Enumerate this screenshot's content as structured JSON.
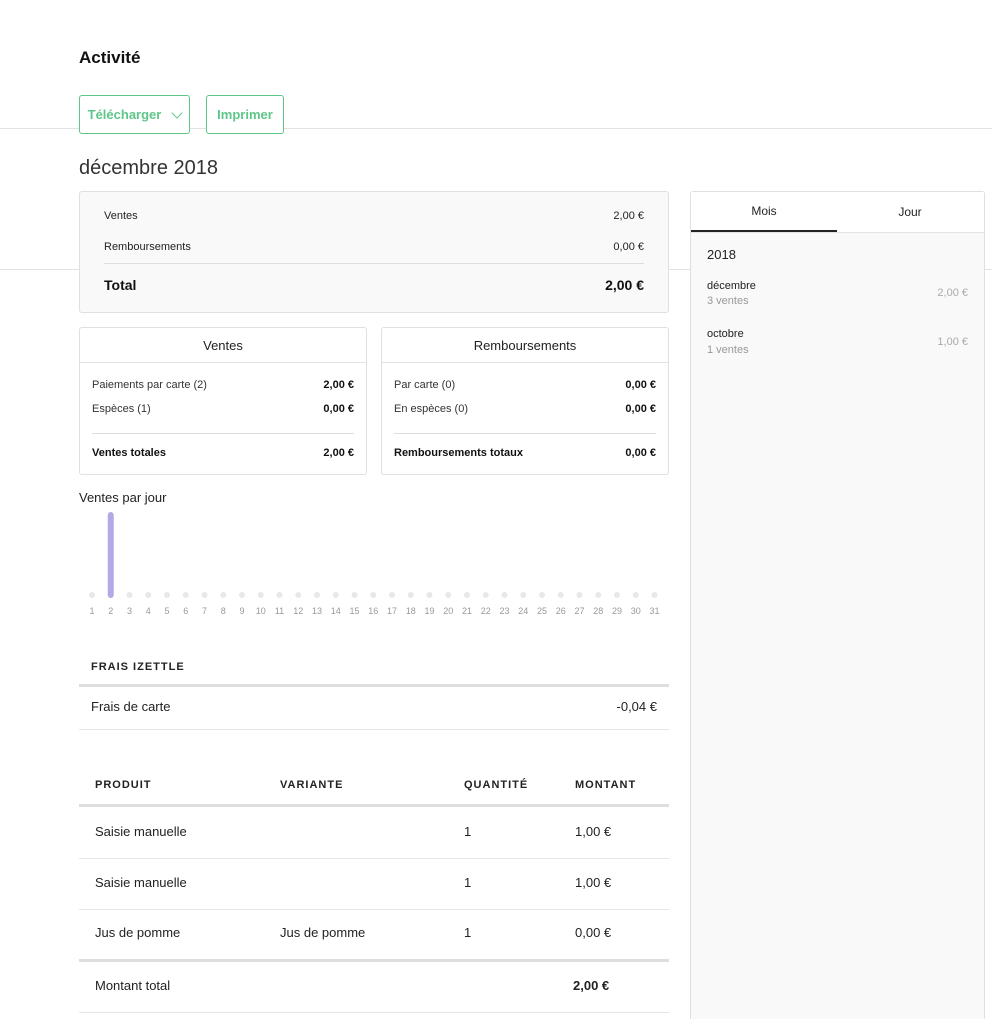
{
  "page": {
    "title": "Activité"
  },
  "toolbar": {
    "download_label": "Télécharger",
    "print_label": "Imprimer"
  },
  "period": {
    "title": "décembre 2018"
  },
  "summary": {
    "sales_label": "Ventes",
    "sales_value": "2,00 €",
    "refunds_label": "Remboursements",
    "refunds_value": "0,00 €",
    "total_label": "Total",
    "total_value": "2,00 €"
  },
  "sales_card": {
    "title": "Ventes",
    "rows": [
      {
        "label": "Paiements par carte (2)",
        "value": "2,00 €"
      },
      {
        "label": "Espèces (1)",
        "value": "0,00 €"
      }
    ],
    "total_label": "Ventes totales",
    "total_value": "2,00 €"
  },
  "refunds_card": {
    "title": "Remboursements",
    "rows": [
      {
        "label": "Par carte (0)",
        "value": "0,00 €"
      },
      {
        "label": "En espèces (0)",
        "value": "0,00 €"
      }
    ],
    "total_label": "Remboursements totaux",
    "total_value": "0,00 €"
  },
  "chart_data": {
    "type": "bar",
    "title": "Ventes par jour",
    "categories": [
      "1",
      "2",
      "3",
      "4",
      "5",
      "6",
      "7",
      "8",
      "9",
      "10",
      "11",
      "12",
      "13",
      "14",
      "15",
      "16",
      "17",
      "18",
      "19",
      "20",
      "21",
      "22",
      "23",
      "24",
      "25",
      "26",
      "27",
      "28",
      "29",
      "30",
      "31"
    ],
    "values": [
      0,
      2,
      0,
      0,
      0,
      0,
      0,
      0,
      0,
      0,
      0,
      0,
      0,
      0,
      0,
      0,
      0,
      0,
      0,
      0,
      0,
      0,
      0,
      0,
      0,
      0,
      0,
      0,
      0,
      0,
      0
    ],
    "bar_color": "#b3a9e6",
    "empty_color": "#e8e8e8",
    "grid": false
  },
  "fees": {
    "title": "FRAIS IZETTLE",
    "label": "Frais de carte",
    "value": "-0,04 €"
  },
  "products": {
    "headers": {
      "product": "PRODUIT",
      "variant": "VARIANTE",
      "quantity": "QUANTITÉ",
      "amount": "MONTANT"
    },
    "rows": [
      {
        "product": "Saisie manuelle",
        "variant": "",
        "quantity": "1",
        "amount": "1,00 €"
      },
      {
        "product": "Saisie manuelle",
        "variant": "",
        "quantity": "1",
        "amount": "1,00 €"
      },
      {
        "product": "Jus de pomme",
        "variant": "Jus de pomme",
        "quantity": "1",
        "amount": "0,00 €"
      }
    ],
    "total_label": "Montant total",
    "total_value": "2,00 €"
  },
  "sidebar": {
    "tabs": [
      {
        "label": "Mois"
      },
      {
        "label": "Jour"
      }
    ],
    "year": "2018",
    "months": [
      {
        "name": "décembre",
        "count": "3 ventes",
        "amount": "2,00 €"
      },
      {
        "name": "octobre",
        "count": "1 ventes",
        "amount": "1,00 €"
      }
    ]
  },
  "colors": {
    "accent": "#5fc68a",
    "chart_bar": "#b3a9e6"
  }
}
